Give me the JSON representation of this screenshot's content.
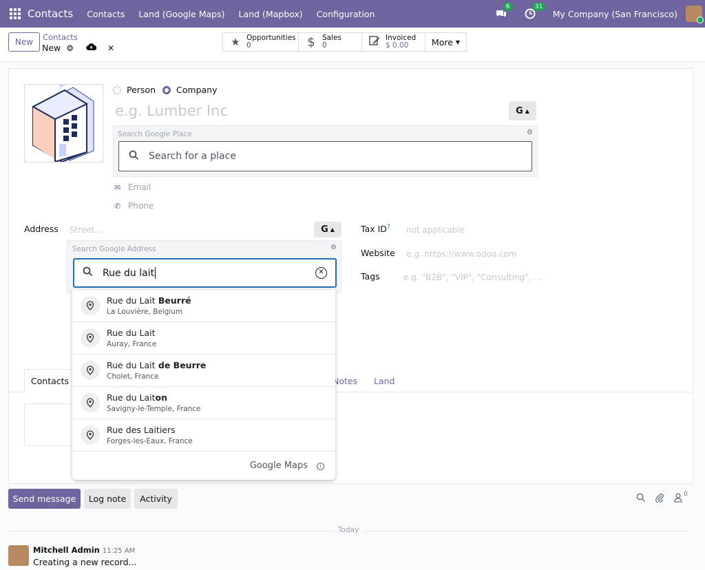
{
  "topbar": {
    "brand": "Contacts",
    "menu": [
      "Contacts",
      "Land (Google Maps)",
      "Land (Mapbox)",
      "Configuration"
    ],
    "chat_badge": "6",
    "activity_badge": "31",
    "company": "My Company (San Francisco)"
  },
  "control": {
    "new_label": "New",
    "breadcrumb_parent": "Contacts",
    "breadcrumb_current": "New",
    "smart_buttons": [
      {
        "label": "Opportunities",
        "value": "0"
      },
      {
        "label": "Sales",
        "value": "0"
      },
      {
        "label": "Invoiced",
        "value": "$ 0.00"
      }
    ],
    "more_label": "More"
  },
  "form": {
    "type_options": [
      "Person",
      "Company"
    ],
    "selected_type": "Company",
    "name_placeholder": "e.g. Lumber Inc",
    "google_button": "G",
    "place_search_label": "Search Google Place",
    "place_placeholder": "Search for a place",
    "email_placeholder": "Email",
    "phone_placeholder": "Phone",
    "address_label": "Address",
    "street_placeholder": "Street...",
    "address_search_label": "Search Google Address",
    "address_query": "Rue du lait",
    "tax_label": "Tax ID",
    "tax_help": "?",
    "tax_placeholder": "not applicable",
    "website_label": "Website",
    "website_placeholder": "e.g. https://www.odoo.com",
    "tags_label": "Tags",
    "tags_placeholder": "e.g. \"B2B\", \"VIP\", \"Consulting\", ...",
    "tabs": [
      "Contacts",
      "Notes",
      "Land"
    ]
  },
  "suggestions": [
    {
      "match": "Rue du Lait",
      "rest": " Beurré",
      "sub": "La Louvière, Belgium"
    },
    {
      "match": "Rue du Lait",
      "rest": "",
      "sub": "Auray, France"
    },
    {
      "match": "Rue du Lait",
      "rest": " de Beurre",
      "sub": "Cholet, France"
    },
    {
      "match": "Rue du Lait",
      "rest": "on",
      "sub": "Savigny-le-Temple, France"
    },
    {
      "match": "Rue des Laitiers",
      "rest": "",
      "sub": "Forges-les-Eaux, France"
    }
  ],
  "google_maps_label": "Google Maps",
  "chatter": {
    "send_message": "Send message",
    "log_note": "Log note",
    "activity": "Activity",
    "followers_count": "0",
    "today": "Today",
    "author": "Mitchell Admin",
    "time": "11:25 AM",
    "body": "Creating a new record..."
  },
  "colors": {
    "brand": "#71639e",
    "badge": "#22a35a",
    "focus": "#1f6fb2"
  }
}
